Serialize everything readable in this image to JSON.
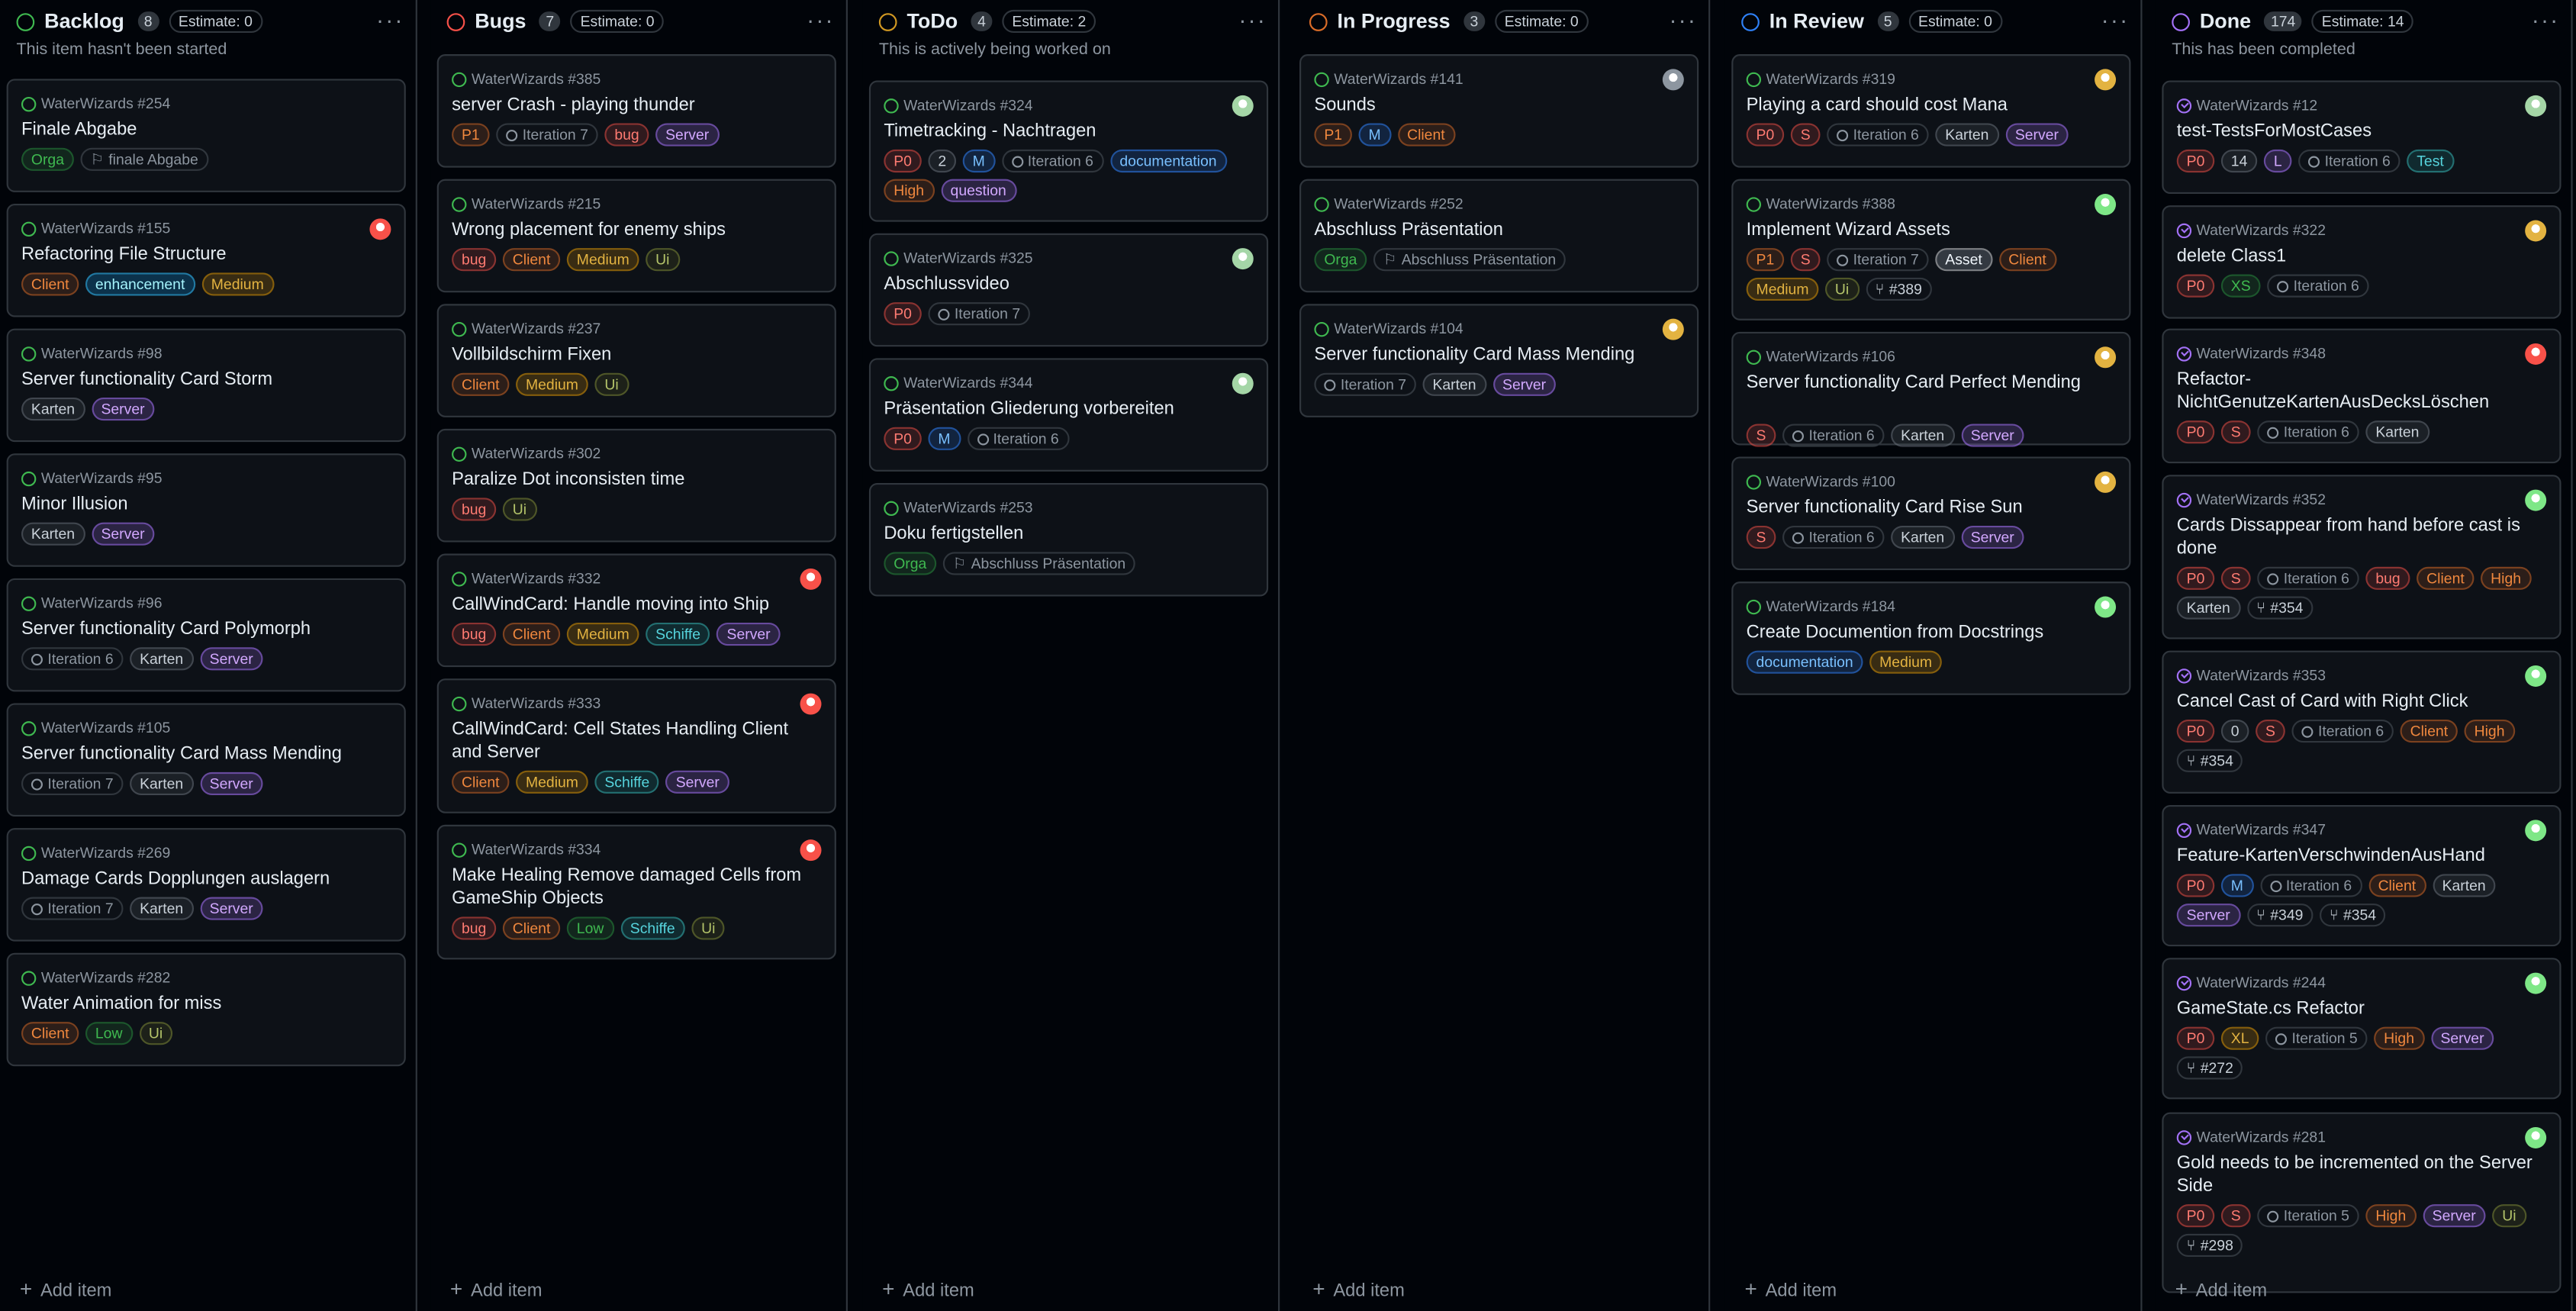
{
  "colors": {
    "green": "#3fb950",
    "orange": "#db6d28",
    "yellow": "#d29922",
    "blue": "#2f81f7",
    "purple": "#a371f7",
    "red": "#f85149"
  },
  "add_item": "Add item",
  "columns": [
    {
      "name": "Backlog",
      "count": "8",
      "estimate": "Estimate: 0",
      "desc": "This item hasn't been started",
      "ring": "#3fb950",
      "cards": [
        {
          "id": "WaterWizards #254",
          "title": "Finale Abgabe",
          "labels": [
            {
              "t": "Orga",
              "k": "green"
            },
            {
              "t": "finale Abgabe",
              "k": "ms"
            }
          ]
        },
        {
          "id": "WaterWizards #155",
          "title": "Refactoring File Structure",
          "avatar": "red",
          "labels": [
            {
              "t": "Client",
              "k": "orange"
            },
            {
              "t": "enhancement",
              "k": "teal"
            },
            {
              "t": "Medium",
              "k": "yellow"
            }
          ]
        },
        {
          "id": "WaterWizards #98",
          "title": "Server functionality Card Storm",
          "labels": [
            {
              "t": "Karten",
              "k": "gray"
            },
            {
              "t": "Server",
              "k": "purple"
            }
          ]
        },
        {
          "id": "WaterWizards #95",
          "title": "Minor Illusion",
          "labels": [
            {
              "t": "Karten",
              "k": "gray"
            },
            {
              "t": "Server",
              "k": "purple"
            }
          ]
        },
        {
          "id": "WaterWizards #96",
          "title": "Server functionality Card Polymorph",
          "labels": [
            {
              "t": "Iteration 6",
              "k": "it"
            },
            {
              "t": "Karten",
              "k": "gray"
            },
            {
              "t": "Server",
              "k": "purple"
            }
          ]
        },
        {
          "id": "WaterWizards #105",
          "title": "Server functionality Card Mass Mending",
          "labels": [
            {
              "t": "Iteration 7",
              "k": "it"
            },
            {
              "t": "Karten",
              "k": "gray"
            },
            {
              "t": "Server",
              "k": "purple"
            }
          ]
        },
        {
          "id": "WaterWizards #269",
          "title": "Damage Cards Dopplungen auslagern",
          "labels": [
            {
              "t": "Iteration 7",
              "k": "it"
            },
            {
              "t": "Karten",
              "k": "gray"
            },
            {
              "t": "Server",
              "k": "purple"
            }
          ]
        },
        {
          "id": "WaterWizards #282",
          "title": "Water Animation for miss",
          "labels": [
            {
              "t": "Client",
              "k": "orange"
            },
            {
              "t": "Low",
              "k": "green"
            },
            {
              "t": "Ui",
              "k": "olive"
            }
          ]
        }
      ]
    },
    {
      "name": "Bugs",
      "count": "7",
      "estimate": "Estimate: 0",
      "desc": "",
      "ring": "#f85149",
      "cards": [
        {
          "id": "WaterWizards #385",
          "title": "server Crash - playing thunder",
          "labels": [
            {
              "t": "P1",
              "k": "orange"
            },
            {
              "t": "Iteration 7",
              "k": "it"
            },
            {
              "t": "bug",
              "k": "red"
            },
            {
              "t": "Server",
              "k": "purple"
            }
          ]
        },
        {
          "id": "WaterWizards #215",
          "title": "Wrong placement for enemy ships",
          "labels": [
            {
              "t": "bug",
              "k": "red"
            },
            {
              "t": "Client",
              "k": "orange"
            },
            {
              "t": "Medium",
              "k": "yellow"
            },
            {
              "t": "Ui",
              "k": "olive"
            }
          ]
        },
        {
          "id": "WaterWizards #237",
          "title": "Vollbildschirm Fixen",
          "labels": [
            {
              "t": "Client",
              "k": "orange"
            },
            {
              "t": "Medium",
              "k": "yellow"
            },
            {
              "t": "Ui",
              "k": "olive"
            }
          ]
        },
        {
          "id": "WaterWizards #302",
          "title": "Paralize Dot inconsisten time",
          "labels": [
            {
              "t": "bug",
              "k": "red"
            },
            {
              "t": "Ui",
              "k": "olive"
            }
          ]
        },
        {
          "id": "WaterWizards #332",
          "title": "CallWindCard: Handle moving into Ship",
          "avatar": "red",
          "labels": [
            {
              "t": "bug",
              "k": "red"
            },
            {
              "t": "Client",
              "k": "orange"
            },
            {
              "t": "Medium",
              "k": "yellow"
            },
            {
              "t": "Schiffe",
              "k": "teal2"
            },
            {
              "t": "Server",
              "k": "purple"
            }
          ]
        },
        {
          "id": "WaterWizards #333",
          "title": "CallWindCard: Cell States Handling Client and Server",
          "avatar": "red",
          "labels": [
            {
              "t": "Client",
              "k": "orange"
            },
            {
              "t": "Medium",
              "k": "yellow"
            },
            {
              "t": "Schiffe",
              "k": "teal2"
            },
            {
              "t": "Server",
              "k": "purple"
            }
          ]
        },
        {
          "id": "WaterWizards #334",
          "title": "Make Healing Remove damaged Cells from GameShip Objects",
          "avatar": "red",
          "labels": [
            {
              "t": "bug",
              "k": "red"
            },
            {
              "t": "Client",
              "k": "orange"
            },
            {
              "t": "Low",
              "k": "green"
            },
            {
              "t": "Schiffe",
              "k": "teal2"
            },
            {
              "t": "Ui",
              "k": "olive"
            }
          ]
        }
      ]
    },
    {
      "name": "ToDo",
      "count": "4",
      "estimate": "Estimate: 2",
      "desc": "This is actively being worked on",
      "ring": "#d29922",
      "cards": [
        {
          "id": "WaterWizards #324",
          "title": "Timetracking - Nachtragen",
          "avatar": "multi",
          "labels": [
            {
              "t": "P0",
              "k": "red"
            },
            {
              "t": "2",
              "k": "gray"
            },
            {
              "t": "M",
              "k": "blue"
            },
            {
              "t": "Iteration 6",
              "k": "it"
            },
            {
              "t": "documentation",
              "k": "blue"
            },
            {
              "t": "High",
              "k": "orange"
            },
            {
              "t": "question",
              "k": "purple"
            }
          ]
        },
        {
          "id": "WaterWizards #325",
          "title": "Abschlussvideo",
          "avatar": "multi",
          "labels": [
            {
              "t": "P0",
              "k": "red"
            },
            {
              "t": "Iteration 7",
              "k": "it"
            }
          ]
        },
        {
          "id": "WaterWizards #344",
          "title": "Präsentation Gliederung vorbereiten",
          "avatar": "multi",
          "labels": [
            {
              "t": "P0",
              "k": "red"
            },
            {
              "t": "M",
              "k": "blue"
            },
            {
              "t": "Iteration 6",
              "k": "it"
            }
          ]
        },
        {
          "id": "WaterWizards #253",
          "title": "Doku fertigstellen",
          "labels": [
            {
              "t": "Orga",
              "k": "green"
            },
            {
              "t": "Abschluss Präsentation",
              "k": "ms"
            }
          ]
        }
      ]
    },
    {
      "name": "In Progress",
      "count": "3",
      "estimate": "Estimate: 0",
      "desc": "",
      "ring": "#db6d28",
      "cards": [
        {
          "id": "WaterWizards #141",
          "title": "Sounds",
          "avatar": "gray",
          "labels": [
            {
              "t": "P1",
              "k": "orange"
            },
            {
              "t": "M",
              "k": "blue"
            },
            {
              "t": "Client",
              "k": "orange"
            }
          ]
        },
        {
          "id": "WaterWizards #252",
          "title": "Abschluss Präsentation",
          "labels": [
            {
              "t": "Orga",
              "k": "green"
            },
            {
              "t": "Abschluss Präsentation",
              "k": "ms"
            }
          ]
        },
        {
          "id": "WaterWizards #104",
          "title": "Server functionality Card Mass Mending",
          "avatar": "yellow",
          "labels": [
            {
              "t": "Iteration 7",
              "k": "it"
            },
            {
              "t": "Karten",
              "k": "gray"
            },
            {
              "t": "Server",
              "k": "purple"
            }
          ]
        }
      ]
    },
    {
      "name": "In Review",
      "count": "5",
      "estimate": "Estimate: 0",
      "desc": "",
      "ring": "#2f81f7",
      "cards": [
        {
          "id": "WaterWizards #319",
          "title": "Playing a card should cost Mana",
          "avatar": "yellow",
          "labels": [
            {
              "t": "P0",
              "k": "red"
            },
            {
              "t": "S",
              "k": "red"
            },
            {
              "t": "Iteration 6",
              "k": "it"
            },
            {
              "t": "Karten",
              "k": "gray"
            },
            {
              "t": "Server",
              "k": "purple"
            }
          ]
        },
        {
          "id": "WaterWizards #388",
          "title": "Implement Wizard Assets",
          "avatar": "green",
          "labels": [
            {
              "t": "P1",
              "k": "orange"
            },
            {
              "t": "S",
              "k": "red"
            },
            {
              "t": "Iteration 7",
              "k": "it"
            },
            {
              "t": "Asset",
              "k": "white"
            },
            {
              "t": "Client",
              "k": "orange"
            },
            {
              "t": "Medium",
              "k": "yellow"
            },
            {
              "t": "Ui",
              "k": "olive"
            },
            {
              "t": "#389",
              "k": "pr"
            }
          ]
        },
        {
          "id": "WaterWizards #106",
          "title": "Server functionality Card Perfect Mending",
          "avatar": "yellow",
          "labels": [
            {
              "t": "S",
              "k": "red"
            },
            {
              "t": "Iteration 6",
              "k": "it"
            },
            {
              "t": "Karten",
              "k": "gray"
            },
            {
              "t": "Server",
              "k": "purple"
            }
          ]
        },
        {
          "id": "WaterWizards #100",
          "title": "Server functionality Card Rise Sun",
          "avatar": "yellow",
          "labels": [
            {
              "t": "S",
              "k": "red"
            },
            {
              "t": "Iteration 6",
              "k": "it"
            },
            {
              "t": "Karten",
              "k": "gray"
            },
            {
              "t": "Server",
              "k": "purple"
            }
          ]
        },
        {
          "id": "WaterWizards #184",
          "title": "Create Documention from Docstrings",
          "avatar": "green",
          "labels": [
            {
              "t": "documentation",
              "k": "blue"
            },
            {
              "t": "Medium",
              "k": "yellow"
            }
          ]
        }
      ]
    },
    {
      "name": "Done",
      "count": "174",
      "estimate": "Estimate: 14",
      "desc": "This has been completed",
      "ring": "#a371f7",
      "cards": [
        {
          "id": "WaterWizards #12",
          "title": "test-TestsForMostCases",
          "done": true,
          "avatar": "multi",
          "labels": [
            {
              "t": "P0",
              "k": "red"
            },
            {
              "t": "14",
              "k": "gray"
            },
            {
              "t": "L",
              "k": "purple"
            },
            {
              "t": "Iteration 6",
              "k": "it"
            },
            {
              "t": "Test",
              "k": "teal2"
            }
          ]
        },
        {
          "id": "WaterWizards #322",
          "title": "delete Class1",
          "done": true,
          "avatar": "yellow",
          "labels": [
            {
              "t": "P0",
              "k": "red"
            },
            {
              "t": "XS",
              "k": "green"
            },
            {
              "t": "Iteration 6",
              "k": "it"
            }
          ]
        },
        {
          "id": "WaterWizards #348",
          "title": "Refactor-NichtGenutzeKartenAusDecksLöschen",
          "done": true,
          "avatar": "red",
          "labels": [
            {
              "t": "P0",
              "k": "red"
            },
            {
              "t": "S",
              "k": "red"
            },
            {
              "t": "Iteration 6",
              "k": "it"
            },
            {
              "t": "Karten",
              "k": "gray"
            }
          ]
        },
        {
          "id": "WaterWizards #352",
          "title": "Cards Dissappear from hand before cast is done",
          "done": true,
          "avatar": "green",
          "labels": [
            {
              "t": "P0",
              "k": "red"
            },
            {
              "t": "S",
              "k": "red"
            },
            {
              "t": "Iteration 6",
              "k": "it"
            },
            {
              "t": "bug",
              "k": "red"
            },
            {
              "t": "Client",
              "k": "orange"
            },
            {
              "t": "High",
              "k": "orange"
            },
            {
              "t": "Karten",
              "k": "gray"
            },
            {
              "t": "#354",
              "k": "pr"
            }
          ]
        },
        {
          "id": "WaterWizards #353",
          "title": "Cancel Cast of Card with Right Click",
          "done": true,
          "avatar": "green",
          "labels": [
            {
              "t": "P0",
              "k": "red"
            },
            {
              "t": "0",
              "k": "gray"
            },
            {
              "t": "S",
              "k": "red"
            },
            {
              "t": "Iteration 6",
              "k": "it"
            },
            {
              "t": "Client",
              "k": "orange"
            },
            {
              "t": "High",
              "k": "orange"
            },
            {
              "t": "#354",
              "k": "pr"
            }
          ]
        },
        {
          "id": "WaterWizards #347",
          "title": "Feature-KartenVerschwindenAusHand",
          "done": true,
          "avatar": "green",
          "labels": [
            {
              "t": "P0",
              "k": "red"
            },
            {
              "t": "M",
              "k": "blue"
            },
            {
              "t": "Iteration 6",
              "k": "it"
            },
            {
              "t": "Client",
              "k": "orange"
            },
            {
              "t": "Karten",
              "k": "gray"
            },
            {
              "t": "Server",
              "k": "purple"
            },
            {
              "t": "#349",
              "k": "pr"
            },
            {
              "t": "#354",
              "k": "pr"
            }
          ]
        },
        {
          "id": "WaterWizards #244",
          "title": "GameState.cs Refactor",
          "done": true,
          "avatar": "green",
          "labels": [
            {
              "t": "P0",
              "k": "red"
            },
            {
              "t": "XL",
              "k": "yellow"
            },
            {
              "t": "Iteration 5",
              "k": "it"
            },
            {
              "t": "High",
              "k": "orange"
            },
            {
              "t": "Server",
              "k": "purple"
            },
            {
              "t": "#272",
              "k": "pr"
            }
          ]
        },
        {
          "id": "WaterWizards #281",
          "title": "Gold needs to be incremented on the Server Side",
          "done": true,
          "avatar": "green",
          "labels": [
            {
              "t": "P0",
              "k": "red"
            },
            {
              "t": "S",
              "k": "red"
            },
            {
              "t": "Iteration 5",
              "k": "it"
            },
            {
              "t": "High",
              "k": "orange"
            },
            {
              "t": "Server",
              "k": "purple"
            },
            {
              "t": "Ui",
              "k": "olive"
            },
            {
              "t": "#298",
              "k": "pr"
            }
          ]
        }
      ]
    }
  ]
}
